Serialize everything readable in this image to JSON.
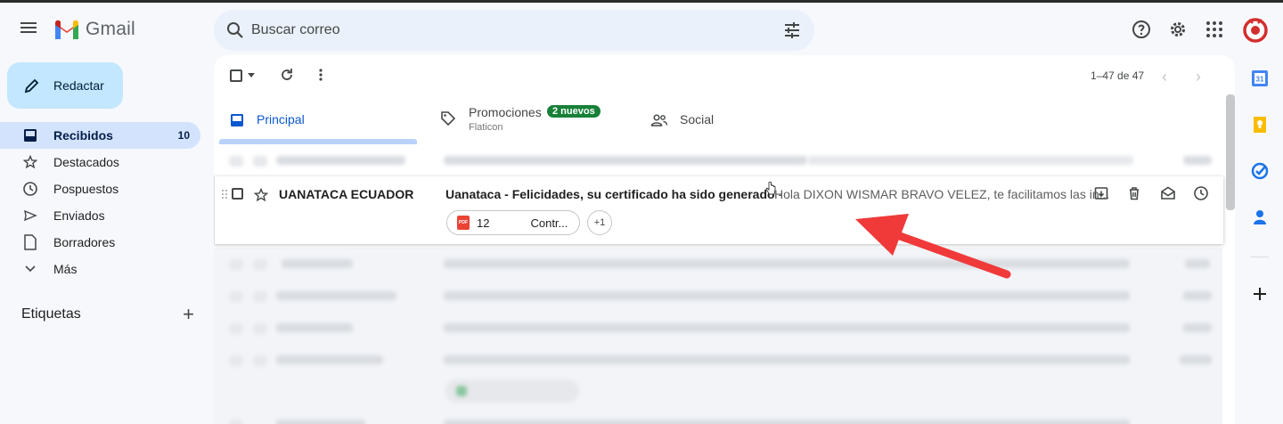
{
  "header": {
    "app_name": "Gmail",
    "search_placeholder": "Buscar correo"
  },
  "nav": {
    "compose_label": "Redactar",
    "items": [
      {
        "label": "Recibidos",
        "count": "10",
        "icon": "inbox-icon"
      },
      {
        "label": "Destacados",
        "count": "",
        "icon": "star-icon"
      },
      {
        "label": "Pospuestos",
        "count": "",
        "icon": "clock-icon"
      },
      {
        "label": "Enviados",
        "count": "",
        "icon": "send-icon"
      },
      {
        "label": "Borradores",
        "count": "",
        "icon": "draft-icon"
      },
      {
        "label": "Más",
        "count": "",
        "icon": "chevron-down-icon"
      }
    ],
    "labels_title": "Etiquetas",
    "labels_add": "+"
  },
  "toolbar": {
    "pager": "1–47 de 47",
    "prev": "‹",
    "next": "›"
  },
  "tabs": {
    "principal": "Principal",
    "promociones": "Promociones",
    "promociones_badge": "2 nuevos",
    "promociones_sub": "Flaticon",
    "social": "Social"
  },
  "highlighted_email": {
    "sender": "UANATACA ECUADOR",
    "subject": "Uanataca - Felicidades, su certificado ha sido generado",
    "separator": " - ",
    "snippet": "Hola DIXON WISMAR BRAVO VELEZ, te facilitamos las in...",
    "attachment_number": "12",
    "attachment_name": "Contr...",
    "attachment_type": "PDF",
    "more_attachments": "+1"
  },
  "colors": {
    "accent": "#0b57d0",
    "compose_bg": "#c2e7ff",
    "active_nav_bg": "#d3e3fd",
    "badge_green": "#188038",
    "arrow_red": "#f03a3a"
  }
}
